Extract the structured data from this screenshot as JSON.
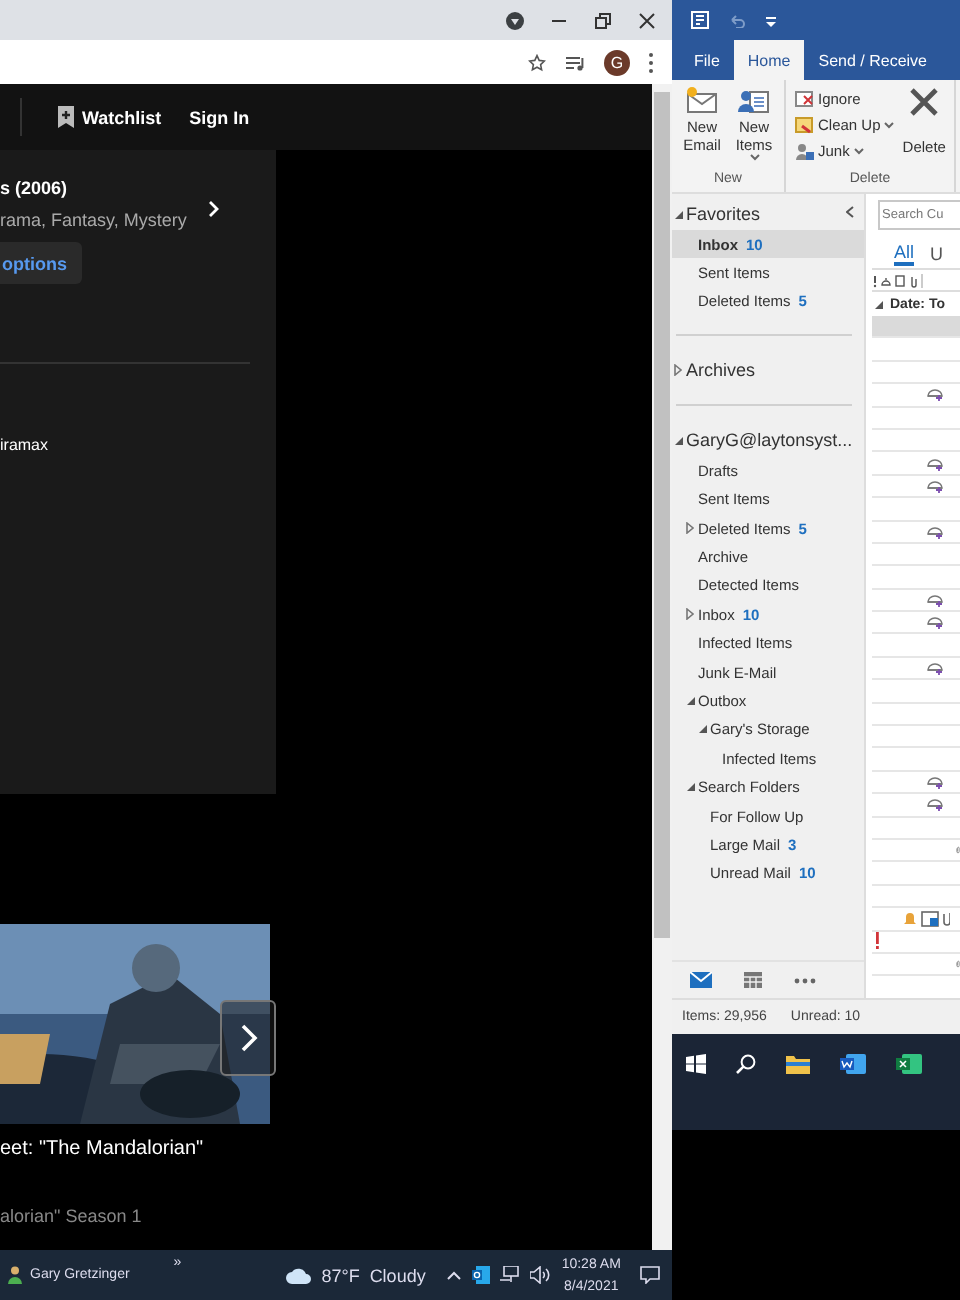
{
  "browser": {
    "avatar": "G",
    "site_nav": [
      {
        "label": "Watchlist"
      },
      {
        "label": "Sign In"
      }
    ],
    "title_panel": {
      "title": "s (2006)",
      "genres": "rama, Fantasy, Mystery",
      "options_button": "options",
      "studio": "iramax"
    },
    "featured": {
      "title": "eet: \"The Mandalorian\"",
      "subtitle": "alorian\" Season 1"
    }
  },
  "outlook": {
    "tabs": [
      {
        "label": "File",
        "selected": false
      },
      {
        "label": "Home",
        "selected": true
      },
      {
        "label": "Send / Receive",
        "selected": false
      }
    ],
    "ribbon_groups": [
      {
        "label": "New",
        "buttons": [
          {
            "kind": "new-email",
            "label": "New Email",
            "dropdown": false
          },
          {
            "kind": "new-items",
            "label": "New Items",
            "dropdown": true
          }
        ]
      },
      {
        "label": "Delete",
        "buttons": [
          {
            "kind": "ignore",
            "label": "Ignore",
            "dropdown": false
          },
          {
            "kind": "clean-up",
            "label": "Clean Up",
            "dropdown": true
          },
          {
            "kind": "junk",
            "label": "Junk",
            "dropdown": true
          },
          {
            "kind": "delete",
            "label": "Delete",
            "dropdown": false
          }
        ]
      }
    ],
    "folder_sections": [
      {
        "label": "Favorites",
        "expanded": true,
        "children": [
          {
            "label": "Inbox",
            "count": "10",
            "selected": true
          },
          {
            "label": "Sent Items",
            "selected": false
          },
          {
            "label": "Deleted Items",
            "count": "5",
            "selected": false
          }
        ]
      },
      {
        "label": "Archives",
        "expanded": false
      },
      {
        "label": "GaryG@laytonsyst...",
        "expanded": true,
        "children": [
          {
            "label": "Drafts",
            "selected": false
          },
          {
            "label": "Sent Items",
            "selected": false
          },
          {
            "label": "Deleted Items",
            "count": "5",
            "expanded": false,
            "selected": false
          },
          {
            "label": "Archive",
            "selected": false
          },
          {
            "label": "Detected Items",
            "selected": false
          },
          {
            "label": "Inbox",
            "count": "10",
            "expanded": false,
            "selected": false
          },
          {
            "label": "Infected Items",
            "selected": false
          },
          {
            "label": "Junk E-Mail",
            "selected": false
          },
          {
            "label": "Outbox",
            "expanded": true,
            "selected": false,
            "children": [
              {
                "label": "Gary's Storage",
                "expanded": true,
                "selected": false,
                "children": [
                  {
                    "label": "Infected Items",
                    "selected": false
                  }
                ]
              }
            ]
          },
          {
            "label": "Search Folders",
            "expanded": true,
            "selected": false,
            "children": [
              {
                "label": "For Follow Up",
                "selected": false
              },
              {
                "label": "Large Mail",
                "count": "3",
                "selected": false
              },
              {
                "label": "Unread Mail",
                "count": "10",
                "selected": false
              }
            ]
          }
        ]
      }
    ],
    "search": {
      "placeholder": "Search Cu"
    },
    "filters": [
      {
        "label": "All",
        "selected": true
      },
      {
        "label": "U",
        "selected": false
      }
    ],
    "group_header": "Date: To",
    "messages": [
      {
        "kind": "none",
        "selected": true
      },
      {
        "kind": "none",
        "selected": false
      },
      {
        "kind": "none",
        "selected": false
      },
      {
        "kind": "meeting",
        "selected": false
      },
      {
        "kind": "none",
        "selected": false
      },
      {
        "kind": "none",
        "selected": false
      },
      {
        "kind": "meeting",
        "selected": false
      },
      {
        "kind": "meeting",
        "selected": false
      },
      {
        "kind": "none",
        "selected": false
      },
      {
        "kind": "meeting",
        "selected": false
      },
      {
        "kind": "none",
        "selected": false
      },
      {
        "kind": "none",
        "selected": false
      },
      {
        "kind": "meeting",
        "selected": false
      },
      {
        "kind": "meeting",
        "selected": false
      },
      {
        "kind": "none",
        "selected": false
      },
      {
        "kind": "meeting",
        "selected": false
      },
      {
        "kind": "none",
        "selected": false
      },
      {
        "kind": "none",
        "selected": false
      },
      {
        "kind": "none",
        "selected": false
      },
      {
        "kind": "none",
        "selected": false
      },
      {
        "kind": "meeting",
        "selected": false
      },
      {
        "kind": "meeting",
        "selected": false
      },
      {
        "kind": "none",
        "selected": false
      },
      {
        "kind": "attachment",
        "selected": false
      },
      {
        "kind": "none",
        "selected": false
      },
      {
        "kind": "none",
        "selected": false
      },
      {
        "kind": "reminder",
        "selected": false
      },
      {
        "kind": "important",
        "selected": false
      },
      {
        "kind": "attachment",
        "selected": false
      }
    ],
    "status_bar": {
      "items": "Items: 29,956",
      "unread": "Unread: 10"
    }
  },
  "taskbar": {
    "user": "Gary Gretzinger",
    "overflow": "»",
    "temperature": "87°F",
    "condition": "Cloudy",
    "time": "10:28 AM",
    "date": "8/4/2021"
  }
}
